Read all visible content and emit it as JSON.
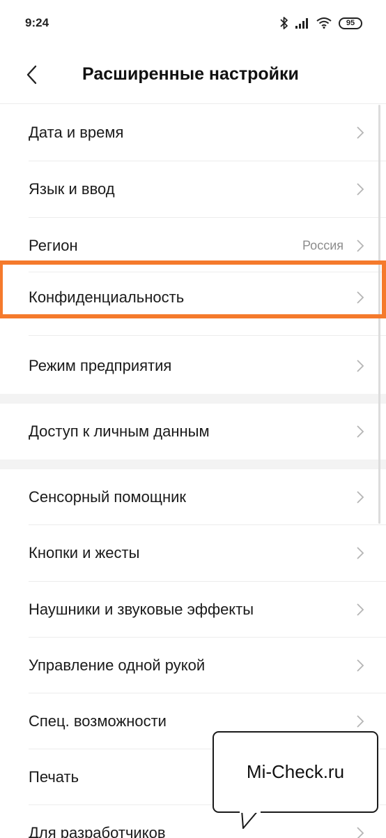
{
  "status_bar": {
    "time": "9:24",
    "battery_level": "95",
    "icons": [
      "bluetooth-icon",
      "signal-icon",
      "wifi-icon",
      "battery-icon"
    ]
  },
  "header": {
    "title": "Расширенные настройки",
    "back_icon": "chevron-left-icon"
  },
  "settings": {
    "items": [
      {
        "label": "Дата и время"
      },
      {
        "label": "Язык и ввод"
      },
      {
        "label": "Регион",
        "value": "Россия"
      },
      {
        "label": "Конфиденциальность"
      },
      {
        "label": "Режим предприятия"
      },
      {
        "label": "Доступ к личным данным"
      },
      {
        "label": "Сенсорный помощник"
      },
      {
        "label": "Кнопки и жесты"
      },
      {
        "label": "Наушники и звуковые эффекты"
      },
      {
        "label": "Управление одной рукой"
      },
      {
        "label": "Спец. возможности"
      },
      {
        "label": "Печать"
      },
      {
        "label": "Для разработчиков"
      }
    ]
  },
  "watermark": {
    "text": "Mi-Check.ru"
  },
  "colors": {
    "highlight": "#f57a2c",
    "section_band": "#f3f3f3",
    "value_text": "#8c8c8c"
  }
}
